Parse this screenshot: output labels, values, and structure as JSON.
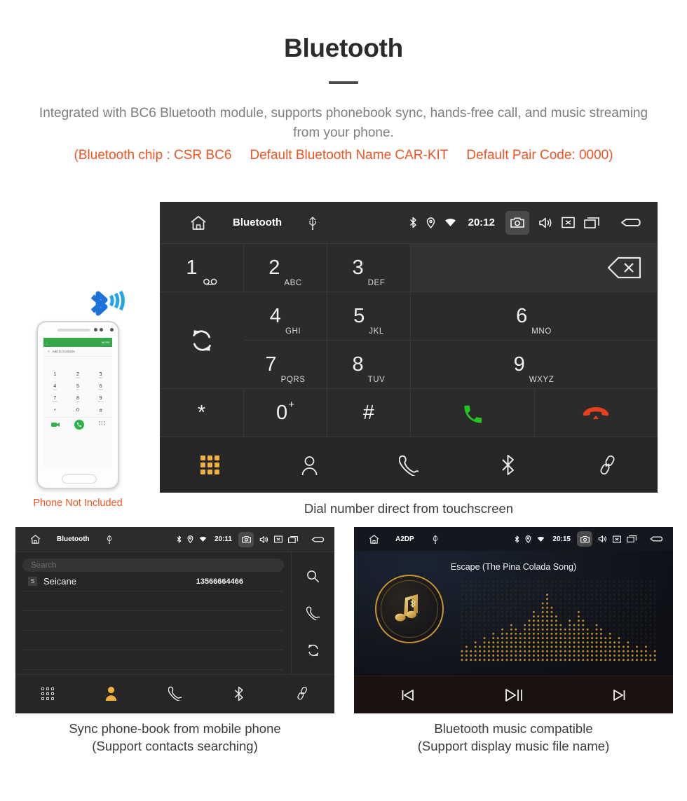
{
  "header": {
    "title": "Bluetooth",
    "subtitle": "Integrated with BC6 Bluetooth module, supports phonebook sync, hands-free call, and music streaming from your phone.",
    "spec_chip": "(Bluetooth chip : CSR BC6",
    "spec_name": "Default Bluetooth Name CAR-KIT",
    "spec_pair": "Default Pair Code: 0000)",
    "accent_color": "#f05423",
    "subtitle_color": "#7d7d7d"
  },
  "phone_mock": {
    "appbar_back": "←",
    "appbar_more": "MORE",
    "add_contacts": "Add to Contacts",
    "plus": "+",
    "keys": [
      {
        "d": "1",
        "l": "∞"
      },
      {
        "d": "2",
        "l": "ABC"
      },
      {
        "d": "3",
        "l": "DEF"
      },
      {
        "d": "4",
        "l": "GHI"
      },
      {
        "d": "5",
        "l": "JKL"
      },
      {
        "d": "6",
        "l": "MNO"
      },
      {
        "d": "7",
        "l": "PQRS"
      },
      {
        "d": "8",
        "l": "TUV"
      },
      {
        "d": "9",
        "l": "WXYZ"
      },
      {
        "d": "*",
        "l": ""
      },
      {
        "d": "0",
        "l": "+"
      },
      {
        "d": "#",
        "l": ""
      }
    ],
    "caption": "Phone Not Included"
  },
  "main_screen": {
    "statusbar": {
      "title": "Bluetooth",
      "time": "20:12",
      "icons": [
        "home-icon",
        "usb-icon",
        "bluetooth-icon",
        "location-icon",
        "wifi-icon",
        "camera-icon",
        "volume-icon",
        "close-icon",
        "recents-icon",
        "back-icon"
      ]
    },
    "keypad": [
      {
        "digit": "1",
        "letters": "",
        "voicemail": true
      },
      {
        "digit": "2",
        "letters": "ABC"
      },
      {
        "digit": "3",
        "letters": "DEF"
      },
      {
        "digit": "4",
        "letters": "GHI"
      },
      {
        "digit": "5",
        "letters": "JKL"
      },
      {
        "digit": "6",
        "letters": "MNO"
      },
      {
        "digit": "7",
        "letters": "PQRS"
      },
      {
        "digit": "8",
        "letters": "TUV"
      },
      {
        "digit": "9",
        "letters": "WXYZ"
      },
      {
        "digit": "*",
        "letters": ""
      },
      {
        "digit": "0",
        "letters": "",
        "plus": "+"
      },
      {
        "digit": "#",
        "letters": ""
      }
    ],
    "actions": {
      "backspace": "backspace-icon",
      "sync": "sync-icon",
      "call": "call-icon",
      "hangup": "hangup-icon",
      "call_color": "#22c522",
      "hangup_color": "#e8401f"
    },
    "tabs": [
      {
        "name": "dialpad",
        "active": true
      },
      {
        "name": "contacts",
        "active": false
      },
      {
        "name": "call-log",
        "active": false
      },
      {
        "name": "bluetooth",
        "active": false
      },
      {
        "name": "pair-link",
        "active": false
      }
    ],
    "active_tab_color": "#f2b13c",
    "caption": "Dial number direct from touchscreen"
  },
  "phonebook_screen": {
    "statusbar": {
      "title": "Bluetooth",
      "time": "20:11"
    },
    "search_placeholder": "Search",
    "contacts": [
      {
        "initial": "S",
        "name": "Seicane",
        "number": "13566664466"
      }
    ],
    "empty_rows": 4,
    "side_actions": [
      "search-icon",
      "call-icon",
      "sync-icon"
    ],
    "tabs": [
      {
        "name": "dialpad",
        "active": false
      },
      {
        "name": "contacts",
        "active": true
      },
      {
        "name": "call-log",
        "active": false
      },
      {
        "name": "bluetooth",
        "active": false
      },
      {
        "name": "pair-link",
        "active": false
      }
    ],
    "caption_line1": "Sync phone-book from mobile phone",
    "caption_line2": "(Support contacts searching)"
  },
  "music_screen": {
    "statusbar": {
      "title": "A2DP",
      "time": "20:15"
    },
    "track_title": "Escape (The Pina Colada Song)",
    "album_icon": "music-note-bluetooth-icon",
    "controls": [
      {
        "name": "previous-track",
        "glyph": "⏮"
      },
      {
        "name": "play-pause",
        "glyph": "⏯"
      },
      {
        "name": "next-track",
        "glyph": "⏭"
      }
    ],
    "accent_gold": "#c9952f",
    "caption_line1": "Bluetooth music compatible",
    "caption_line2": "(Support display music file name)"
  }
}
